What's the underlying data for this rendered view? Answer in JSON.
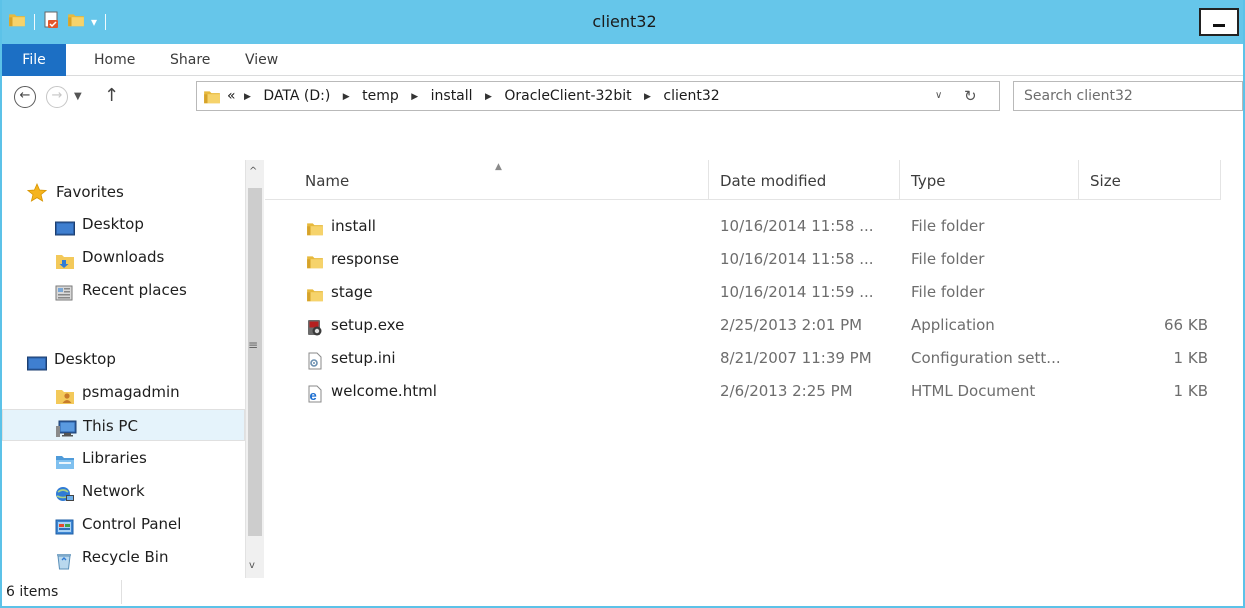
{
  "window": {
    "title": "client32",
    "accent": "#66c6ea"
  },
  "ribbon": {
    "tabs": [
      {
        "label": "File"
      },
      {
        "label": "Home"
      },
      {
        "label": "Share"
      },
      {
        "label": "View"
      }
    ],
    "active_color": "#1c6fc4"
  },
  "address": {
    "overflow": "«",
    "crumbs": [
      "DATA (D:)",
      "temp",
      "install",
      "OracleClient-32bit",
      "client32"
    ],
    "search_placeholder": "Search client32"
  },
  "nav": {
    "items": [
      {
        "label": "Favorites",
        "icon": "star-icon"
      },
      {
        "label": "Desktop",
        "icon": "desktop-icon"
      },
      {
        "label": "Downloads",
        "icon": "downloads-folder-icon"
      },
      {
        "label": "Recent places",
        "icon": "recent-places-icon"
      },
      {
        "label": "Desktop",
        "icon": "desktop-icon"
      },
      {
        "label": "psmagadmin",
        "icon": "user-folder-icon"
      },
      {
        "label": "This PC",
        "icon": "computer-icon",
        "selected": true
      },
      {
        "label": "Libraries",
        "icon": "libraries-icon"
      },
      {
        "label": "Network",
        "icon": "network-icon"
      },
      {
        "label": "Control Panel",
        "icon": "control-panel-icon"
      },
      {
        "label": "Recycle Bin",
        "icon": "recycle-bin-icon"
      }
    ]
  },
  "list": {
    "columns": [
      "Name",
      "Date modified",
      "Type",
      "Size"
    ],
    "rows": [
      {
        "name": "install",
        "date": "10/16/2014 11:58 ...",
        "type": "File folder",
        "size": "",
        "icon": "folder-icon"
      },
      {
        "name": "response",
        "date": "10/16/2014 11:58 ...",
        "type": "File folder",
        "size": "",
        "icon": "folder-icon"
      },
      {
        "name": "stage",
        "date": "10/16/2014 11:59 ...",
        "type": "File folder",
        "size": "",
        "icon": "folder-icon"
      },
      {
        "name": "setup.exe",
        "date": "2/25/2013 2:01 PM",
        "type": "Application",
        "size": "66 KB",
        "icon": "installer-icon"
      },
      {
        "name": "setup.ini",
        "date": "8/21/2007 11:39 PM",
        "type": "Configuration sett...",
        "size": "1 KB",
        "icon": "settings-file-icon"
      },
      {
        "name": "welcome.html",
        "date": "2/6/2013 2:25 PM",
        "type": "HTML Document",
        "size": "1 KB",
        "icon": "html-document-icon"
      }
    ]
  },
  "status": {
    "item_count": "6 items"
  }
}
